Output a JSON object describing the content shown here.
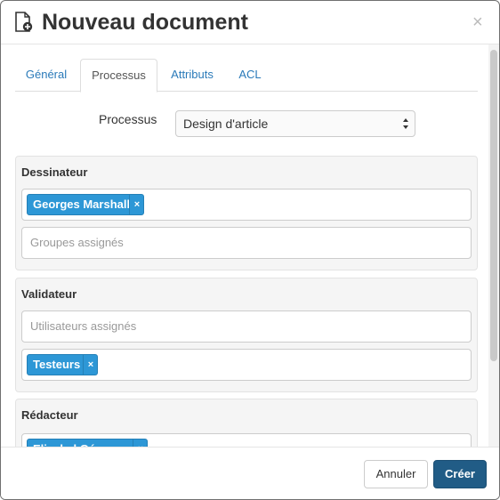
{
  "header": {
    "title": "Nouveau document",
    "close_label": "×"
  },
  "tabs": [
    {
      "label": "Général"
    },
    {
      "label": "Processus"
    },
    {
      "label": "Attributs"
    },
    {
      "label": "ACL"
    }
  ],
  "active_tab": "Processus",
  "process": {
    "label": "Processus",
    "selected": "Design d'article"
  },
  "roles": [
    {
      "title": "Dessinateur",
      "users_chips": [
        "Georges Marshall"
      ],
      "groups_placeholder": "Groupes assignés"
    },
    {
      "title": "Validateur",
      "users_placeholder": "Utilisateurs assignés",
      "groups_chips": [
        "Testeurs"
      ]
    },
    {
      "title": "Rédacteur",
      "users_chips": [
        "Elisabel Géraume"
      ]
    }
  ],
  "chip_remove_label": "×",
  "footer": {
    "cancel_label": "Annuler",
    "create_label": "Créer"
  },
  "colors": {
    "chip": "#2d97d6",
    "primary_button": "#215c86",
    "link": "#2a7ab9"
  }
}
